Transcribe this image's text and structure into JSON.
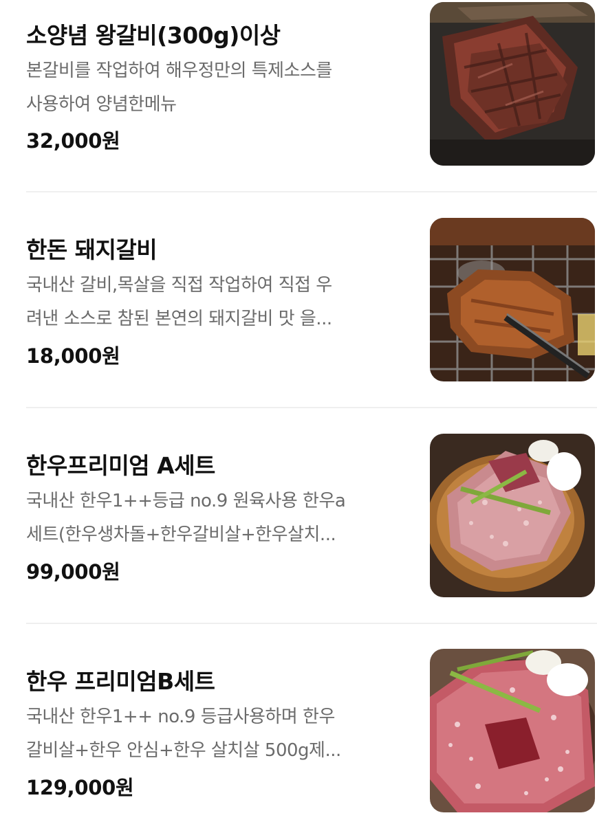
{
  "menu": {
    "items": [
      {
        "name": "소양념 왕갈비(300g)이상",
        "desc_line1": "본갈비를 작업하여 해우정만의 특제소스를",
        "desc_line2": "사용하여 양념한메뉴",
        "price": "32,000원",
        "image": "marinated-beef-ribs-photo"
      },
      {
        "name": "한돈 돼지갈비",
        "desc_line1": "국내산 갈비,목살을 직접 작업하여 직접 우",
        "desc_line2": "려낸 소스로 참된 본연의 돼지갈비 맛 을...",
        "price": "18,000원",
        "image": "grilled-pork-ribs-photo"
      },
      {
        "name": "한우프리미엄 A세트",
        "desc_line1": "국내산 한우1++등급 no.9 원육사용 한우a",
        "desc_line2": "세트(한우생차돌+한우갈비살+한우살치...",
        "price": "99,000원",
        "image": "hanwoo-beef-platter-photo"
      },
      {
        "name": "한우 프리미엄B세트",
        "desc_line1": "국내산 한우1++ no.9 등급사용하며 한우",
        "desc_line2": "갈비살+한우 안심+한우 살치살 500g제...",
        "price": "129,000원",
        "image": "hanwoo-premium-platter-photo"
      }
    ]
  }
}
